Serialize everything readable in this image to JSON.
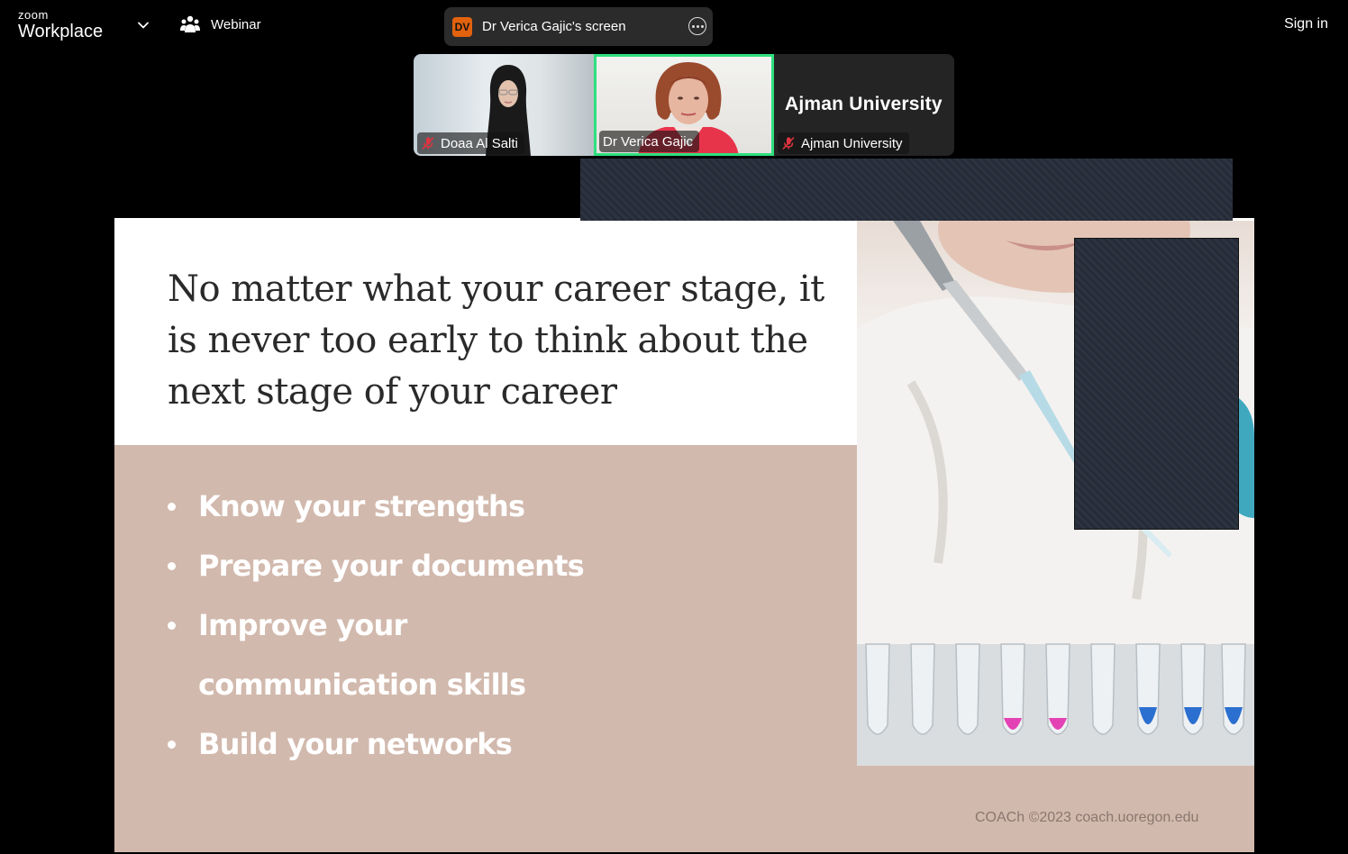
{
  "app": {
    "logo_small": "zoom",
    "logo_large": "Workplace",
    "mode_label": "Webinar",
    "sign_in_label": "Sign in"
  },
  "share": {
    "initials": "DV",
    "label": "Dr Verica Gajic's screen",
    "badge_color": "#e2620e"
  },
  "participants": [
    {
      "name": "Doaa Al Salti",
      "muted": true
    },
    {
      "name": "Dr Verica Gajic",
      "muted": false,
      "active_speaker": true
    },
    {
      "name": "Ajman University",
      "muted": true,
      "display_text": "Ajman University"
    }
  ],
  "slide": {
    "title": "No matter what your career stage, it is never too early to think about the next stage of your career",
    "bullets": [
      "Know your strengths",
      "Prepare your documents",
      "Improve your communication skills",
      "Build your networks"
    ],
    "credit": "COACh ©2023 coach.uoregon.edu",
    "panel_color": "#d2b9ad"
  },
  "colors": {
    "active_speaker_border": "#2ee07e",
    "mute_icon": "#e0343f"
  }
}
